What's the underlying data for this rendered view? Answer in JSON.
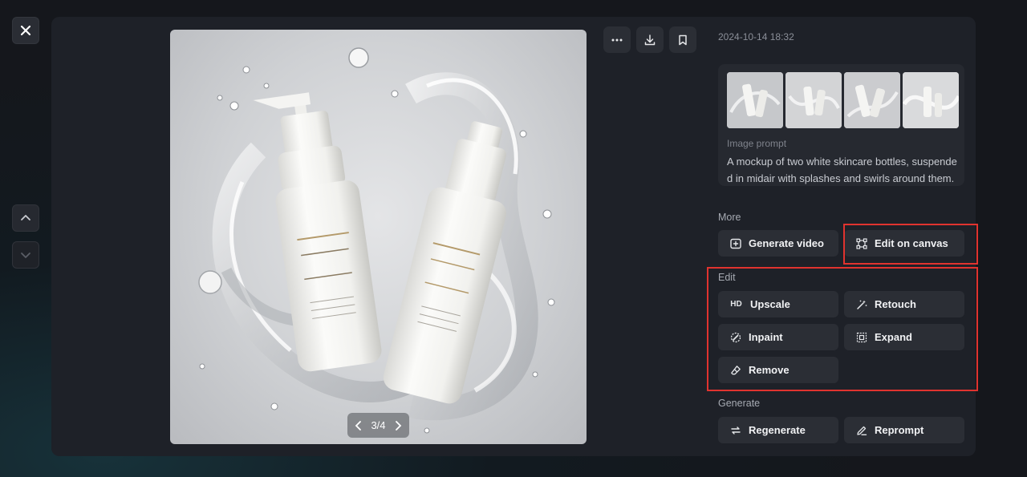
{
  "viewer": {
    "close_icon": "close-icon",
    "prev_icon": "chevron-up-icon",
    "next_icon": "chevron-down-icon",
    "pager_text": "3/4",
    "toolbar": [
      "more-icon",
      "download-icon",
      "bookmark-icon"
    ]
  },
  "details": {
    "timestamp": "2024-10-14 18:32",
    "prompt_label": "Image prompt",
    "prompt_text": "A mockup of two white skincare bottles, suspended in midair with splashes and swirls around them. T"
  },
  "sections": {
    "more": {
      "title": "More",
      "generate_video": "Generate video",
      "edit_on_canvas": "Edit on canvas"
    },
    "edit": {
      "title": "Edit",
      "upscale": "Upscale",
      "upscale_badge": "HD",
      "retouch": "Retouch",
      "inpaint": "Inpaint",
      "expand": "Expand",
      "remove": "Remove"
    },
    "generate": {
      "title": "Generate",
      "regenerate": "Regenerate",
      "reprompt": "Reprompt"
    }
  },
  "colors": {
    "highlight": "#e0332f",
    "panel": "#1e2128",
    "button": "#2b2e35"
  }
}
